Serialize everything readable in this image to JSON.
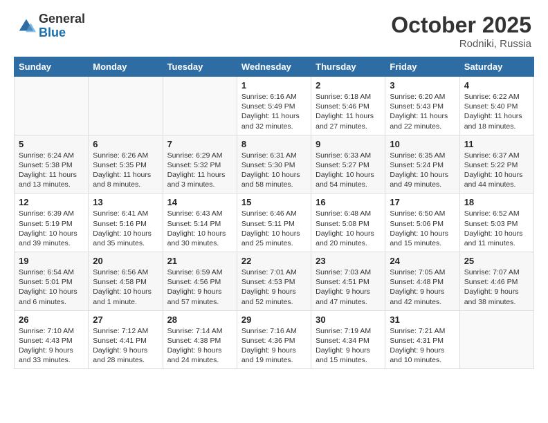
{
  "header": {
    "logo_general": "General",
    "logo_blue": "Blue",
    "month_title": "October 2025",
    "location": "Rodniki, Russia"
  },
  "days_of_week": [
    "Sunday",
    "Monday",
    "Tuesday",
    "Wednesday",
    "Thursday",
    "Friday",
    "Saturday"
  ],
  "weeks": [
    [
      {
        "day": "",
        "info": ""
      },
      {
        "day": "",
        "info": ""
      },
      {
        "day": "",
        "info": ""
      },
      {
        "day": "1",
        "info": "Sunrise: 6:16 AM\nSunset: 5:49 PM\nDaylight: 11 hours\nand 32 minutes."
      },
      {
        "day": "2",
        "info": "Sunrise: 6:18 AM\nSunset: 5:46 PM\nDaylight: 11 hours\nand 27 minutes."
      },
      {
        "day": "3",
        "info": "Sunrise: 6:20 AM\nSunset: 5:43 PM\nDaylight: 11 hours\nand 22 minutes."
      },
      {
        "day": "4",
        "info": "Sunrise: 6:22 AM\nSunset: 5:40 PM\nDaylight: 11 hours\nand 18 minutes."
      }
    ],
    [
      {
        "day": "5",
        "info": "Sunrise: 6:24 AM\nSunset: 5:38 PM\nDaylight: 11 hours\nand 13 minutes."
      },
      {
        "day": "6",
        "info": "Sunrise: 6:26 AM\nSunset: 5:35 PM\nDaylight: 11 hours\nand 8 minutes."
      },
      {
        "day": "7",
        "info": "Sunrise: 6:29 AM\nSunset: 5:32 PM\nDaylight: 11 hours\nand 3 minutes."
      },
      {
        "day": "8",
        "info": "Sunrise: 6:31 AM\nSunset: 5:30 PM\nDaylight: 10 hours\nand 58 minutes."
      },
      {
        "day": "9",
        "info": "Sunrise: 6:33 AM\nSunset: 5:27 PM\nDaylight: 10 hours\nand 54 minutes."
      },
      {
        "day": "10",
        "info": "Sunrise: 6:35 AM\nSunset: 5:24 PM\nDaylight: 10 hours\nand 49 minutes."
      },
      {
        "day": "11",
        "info": "Sunrise: 6:37 AM\nSunset: 5:22 PM\nDaylight: 10 hours\nand 44 minutes."
      }
    ],
    [
      {
        "day": "12",
        "info": "Sunrise: 6:39 AM\nSunset: 5:19 PM\nDaylight: 10 hours\nand 39 minutes."
      },
      {
        "day": "13",
        "info": "Sunrise: 6:41 AM\nSunset: 5:16 PM\nDaylight: 10 hours\nand 35 minutes."
      },
      {
        "day": "14",
        "info": "Sunrise: 6:43 AM\nSunset: 5:14 PM\nDaylight: 10 hours\nand 30 minutes."
      },
      {
        "day": "15",
        "info": "Sunrise: 6:46 AM\nSunset: 5:11 PM\nDaylight: 10 hours\nand 25 minutes."
      },
      {
        "day": "16",
        "info": "Sunrise: 6:48 AM\nSunset: 5:08 PM\nDaylight: 10 hours\nand 20 minutes."
      },
      {
        "day": "17",
        "info": "Sunrise: 6:50 AM\nSunset: 5:06 PM\nDaylight: 10 hours\nand 15 minutes."
      },
      {
        "day": "18",
        "info": "Sunrise: 6:52 AM\nSunset: 5:03 PM\nDaylight: 10 hours\nand 11 minutes."
      }
    ],
    [
      {
        "day": "19",
        "info": "Sunrise: 6:54 AM\nSunset: 5:01 PM\nDaylight: 10 hours\nand 6 minutes."
      },
      {
        "day": "20",
        "info": "Sunrise: 6:56 AM\nSunset: 4:58 PM\nDaylight: 10 hours\nand 1 minute."
      },
      {
        "day": "21",
        "info": "Sunrise: 6:59 AM\nSunset: 4:56 PM\nDaylight: 9 hours\nand 57 minutes."
      },
      {
        "day": "22",
        "info": "Sunrise: 7:01 AM\nSunset: 4:53 PM\nDaylight: 9 hours\nand 52 minutes."
      },
      {
        "day": "23",
        "info": "Sunrise: 7:03 AM\nSunset: 4:51 PM\nDaylight: 9 hours\nand 47 minutes."
      },
      {
        "day": "24",
        "info": "Sunrise: 7:05 AM\nSunset: 4:48 PM\nDaylight: 9 hours\nand 42 minutes."
      },
      {
        "day": "25",
        "info": "Sunrise: 7:07 AM\nSunset: 4:46 PM\nDaylight: 9 hours\nand 38 minutes."
      }
    ],
    [
      {
        "day": "26",
        "info": "Sunrise: 7:10 AM\nSunset: 4:43 PM\nDaylight: 9 hours\nand 33 minutes."
      },
      {
        "day": "27",
        "info": "Sunrise: 7:12 AM\nSunset: 4:41 PM\nDaylight: 9 hours\nand 28 minutes."
      },
      {
        "day": "28",
        "info": "Sunrise: 7:14 AM\nSunset: 4:38 PM\nDaylight: 9 hours\nand 24 minutes."
      },
      {
        "day": "29",
        "info": "Sunrise: 7:16 AM\nSunset: 4:36 PM\nDaylight: 9 hours\nand 19 minutes."
      },
      {
        "day": "30",
        "info": "Sunrise: 7:19 AM\nSunset: 4:34 PM\nDaylight: 9 hours\nand 15 minutes."
      },
      {
        "day": "31",
        "info": "Sunrise: 7:21 AM\nSunset: 4:31 PM\nDaylight: 9 hours\nand 10 minutes."
      },
      {
        "day": "",
        "info": ""
      }
    ]
  ],
  "colors": {
    "header_bg": "#2e6da4",
    "header_text": "#ffffff",
    "border": "#dddddd",
    "cell_shaded": "#f2f2f2"
  }
}
